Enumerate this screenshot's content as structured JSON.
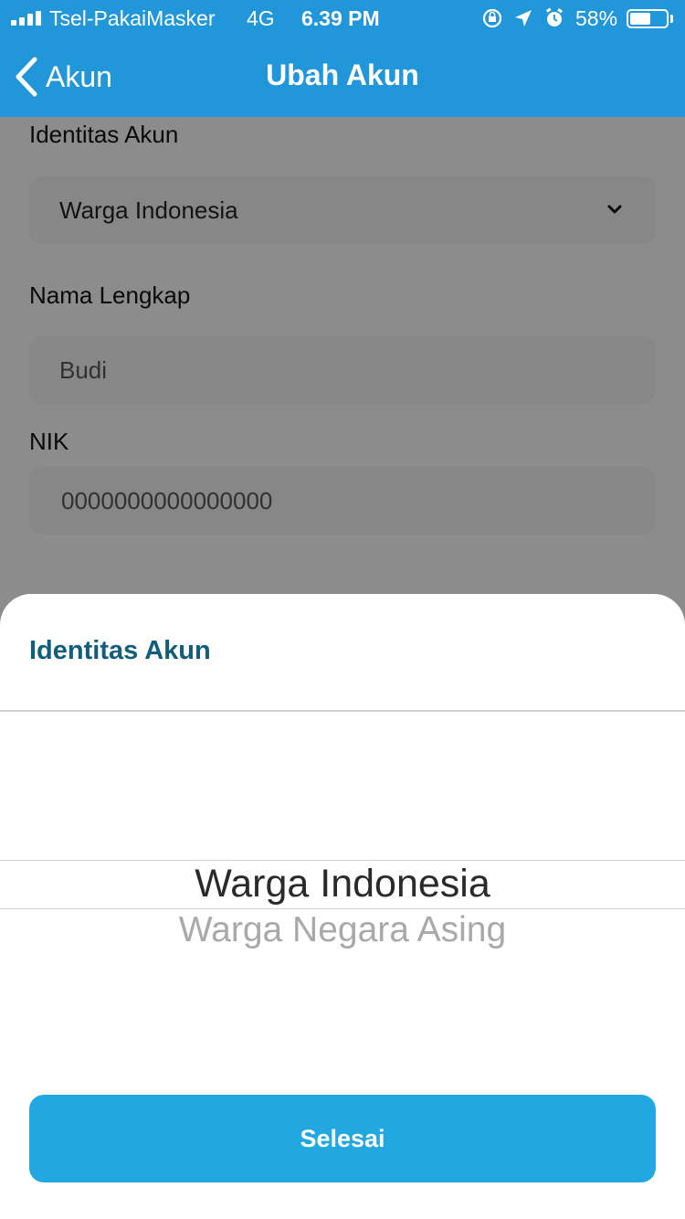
{
  "status_bar": {
    "carrier": "Tsel-PakaiMasker",
    "network": "4G",
    "time": "6.39 PM",
    "battery_percent": "58%",
    "battery_level": 0.58,
    "icons": [
      "signal-icon",
      "orientation-lock-icon",
      "location-icon",
      "alarm-icon",
      "battery-icon"
    ]
  },
  "nav": {
    "back_label": "Akun",
    "title": "Ubah Akun"
  },
  "form": {
    "identity_label": "Identitas Akun",
    "identity_value": "Warga Indonesia",
    "name_label": "Nama Lengkap",
    "name_value": "Budi",
    "nik_label": "NIK",
    "nik_value": "0000000000000000"
  },
  "sheet": {
    "title": "Identitas Akun",
    "options": [
      "Warga Indonesia",
      "Warga Negara Asing"
    ],
    "selected": "Warga Indonesia",
    "done_label": "Selesai"
  },
  "colors": {
    "header": "#2196d9",
    "sheet_title": "#105d7c",
    "button": "#22a8e0"
  }
}
